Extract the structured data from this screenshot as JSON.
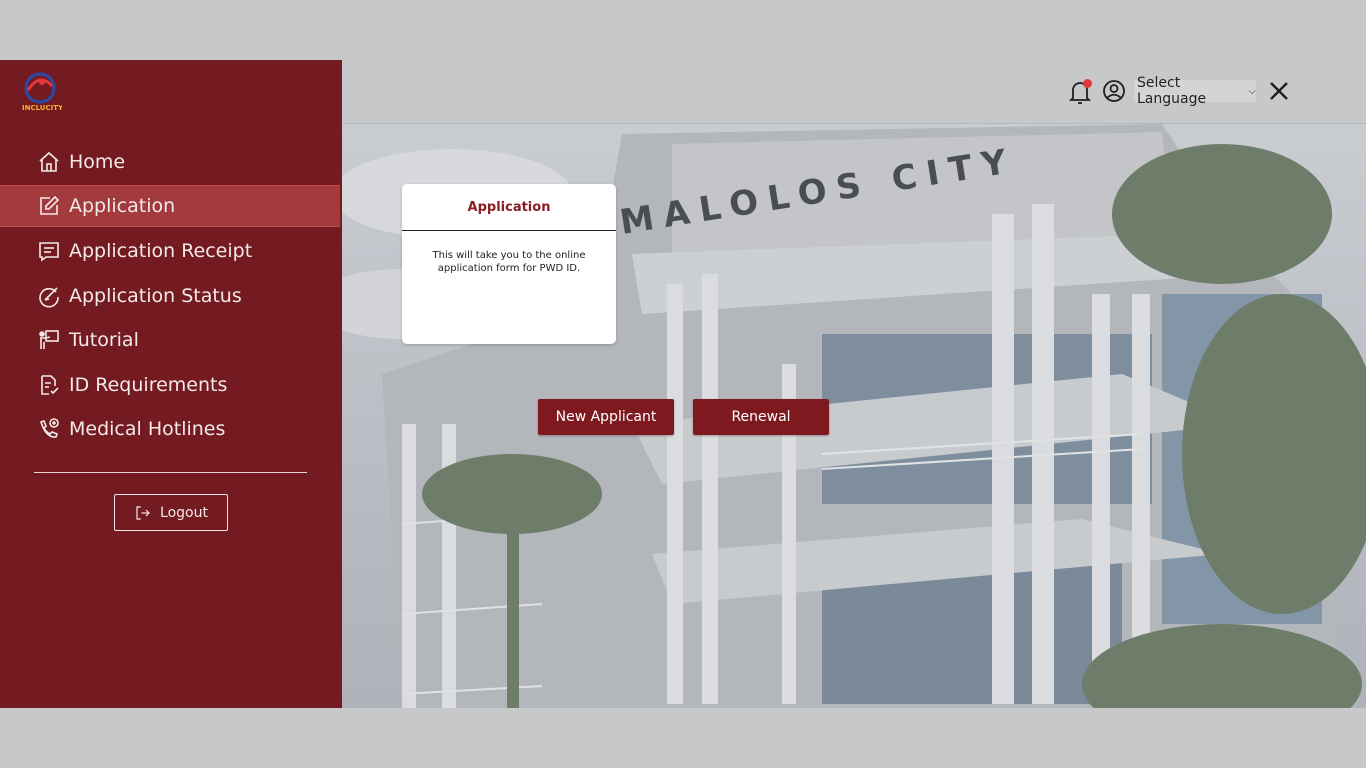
{
  "sidebar": {
    "logo_text": "INCLUCITY",
    "items": [
      {
        "label": "Home",
        "icon": "home-icon"
      },
      {
        "label": "Application",
        "icon": "edit-icon",
        "active": true
      },
      {
        "label": "Application Receipt",
        "icon": "receipt-icon"
      },
      {
        "label": "Application Status",
        "icon": "status-icon"
      },
      {
        "label": "Tutorial",
        "icon": "tutorial-icon"
      },
      {
        "label": "ID Requirements",
        "icon": "document-check-icon"
      },
      {
        "label": "Medical Hotlines",
        "icon": "phone-plus-icon"
      }
    ],
    "logout_label": "Logout"
  },
  "topbar": {
    "language_label": "Select Language"
  },
  "hero": {
    "building_sign": "MALOLOS CITY"
  },
  "card": {
    "title": "Application",
    "description": "This will take you to the online application form for PWD ID."
  },
  "buttons": {
    "new_applicant": "New Applicant",
    "renewal": "Renewal"
  },
  "colors": {
    "sidebar": "#731b20",
    "accent": "#7e1a1f",
    "active_item": "#a23a3e",
    "notification": "#e03b3b"
  }
}
